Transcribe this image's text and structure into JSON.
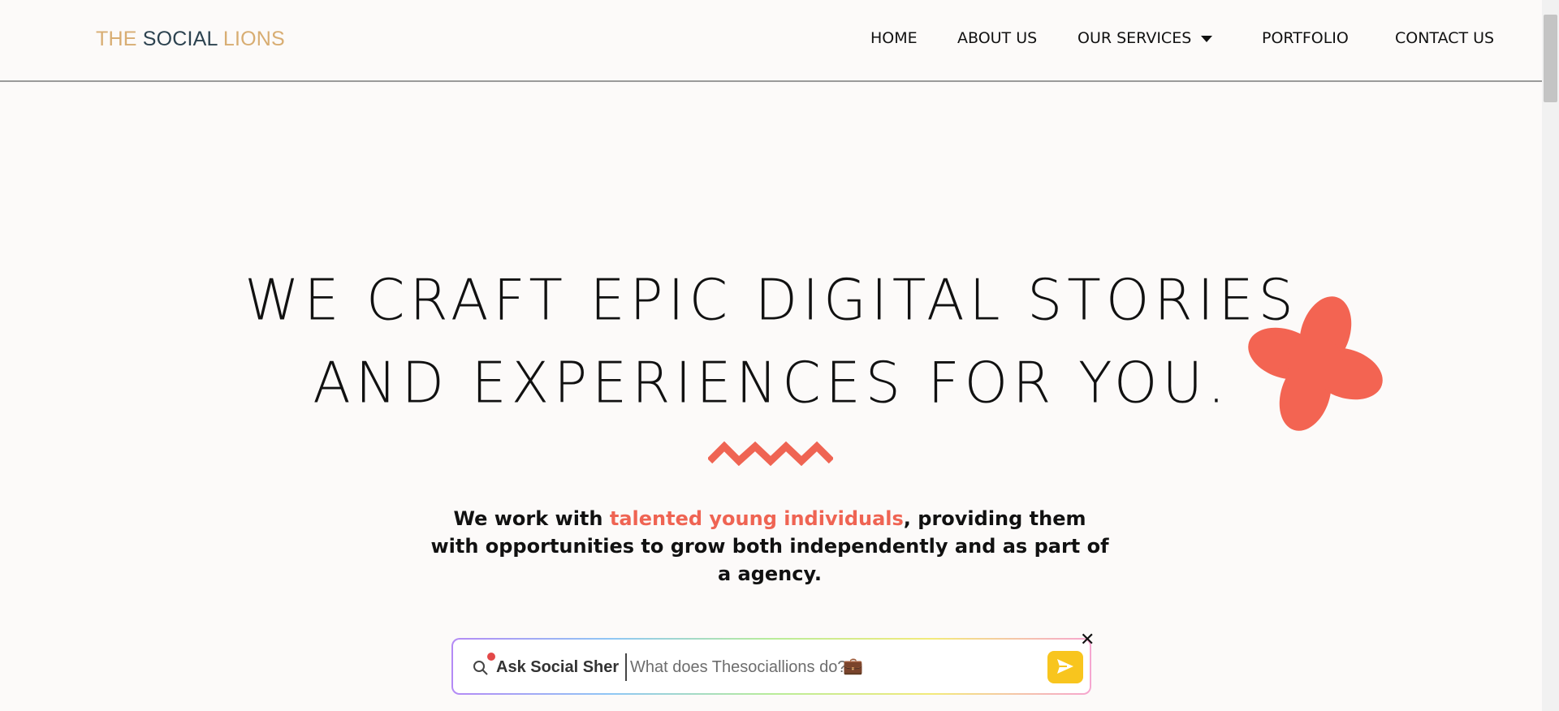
{
  "header": {
    "logo": {
      "part1": "THE",
      "part2": "SOCIAL",
      "part3": "LIONS"
    },
    "nav": [
      {
        "label": "HOME"
      },
      {
        "label": "ABOUT US"
      },
      {
        "label": "OUR SERVICES"
      },
      {
        "label": "PORTFOLIO"
      },
      {
        "label": "CONTACT US"
      }
    ]
  },
  "hero": {
    "title_line1": "WE CRAFT EPIC DIGITAL STORIES",
    "title_line2": "AND EXPERIENCES FOR YOU.",
    "tagline_before": "We work with ",
    "tagline_accent": "talented young individuals",
    "tagline_after": ", providing them with opportunities to grow both independently and as part of a agency."
  },
  "ask_bar": {
    "label": "Ask Social Sher",
    "placeholder": "What does Thesociallions do?",
    "emoji": "💼"
  },
  "colors": {
    "accent": "#ef6453",
    "logo_gold": "#d8ad72",
    "logo_dark": "#2d4350",
    "send_button": "#f8c51e"
  },
  "icons": {
    "services_caret": "caret-down-icon",
    "search": "search-icon",
    "send": "send-icon",
    "close": "close-icon"
  }
}
